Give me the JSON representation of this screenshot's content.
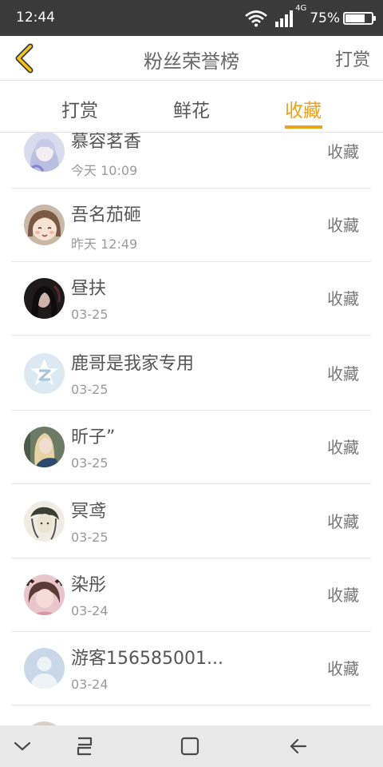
{
  "status_bar": {
    "time": "12:44",
    "network": "4G",
    "battery": "75%",
    "battery_level": 0.75
  },
  "header": {
    "title": "粉丝荣誉榜",
    "right_action": "打赏"
  },
  "tabs": [
    {
      "label": "打赏",
      "active": false
    },
    {
      "label": "鲜花",
      "active": false
    },
    {
      "label": "收藏",
      "active": true
    }
  ],
  "list": [
    {
      "name": "慕容茗香",
      "time": "今天 10:09",
      "action": "收藏",
      "avatar": "anime-girl-avatar"
    },
    {
      "name": "吾名茄砸",
      "time": "昨天 12:49",
      "action": "收藏",
      "avatar": "cartoon-girl-avatar"
    },
    {
      "name": "昼扶",
      "time": "03-25",
      "action": "收藏",
      "avatar": "dark-portrait-avatar"
    },
    {
      "name": "鹿哥是我家专用",
      "time": "03-25",
      "action": "收藏",
      "avatar": "qzone-default-avatar"
    },
    {
      "name": "昕子”",
      "time": "03-25",
      "action": "收藏",
      "avatar": "blonde-portrait-avatar"
    },
    {
      "name": "冥鸢",
      "time": "03-25",
      "action": "收藏",
      "avatar": "sketch-avatar"
    },
    {
      "name": "染彤",
      "time": "03-24",
      "action": "收藏",
      "avatar": "pink-girl-avatar"
    },
    {
      "name": "游客156585001...",
      "time": "03-24",
      "action": "收藏",
      "avatar": "default-person-avatar"
    }
  ],
  "colors": {
    "accent": "#f0a11b",
    "status_bar": "#3a3a3a",
    "navbar": "#e9e9e9"
  }
}
